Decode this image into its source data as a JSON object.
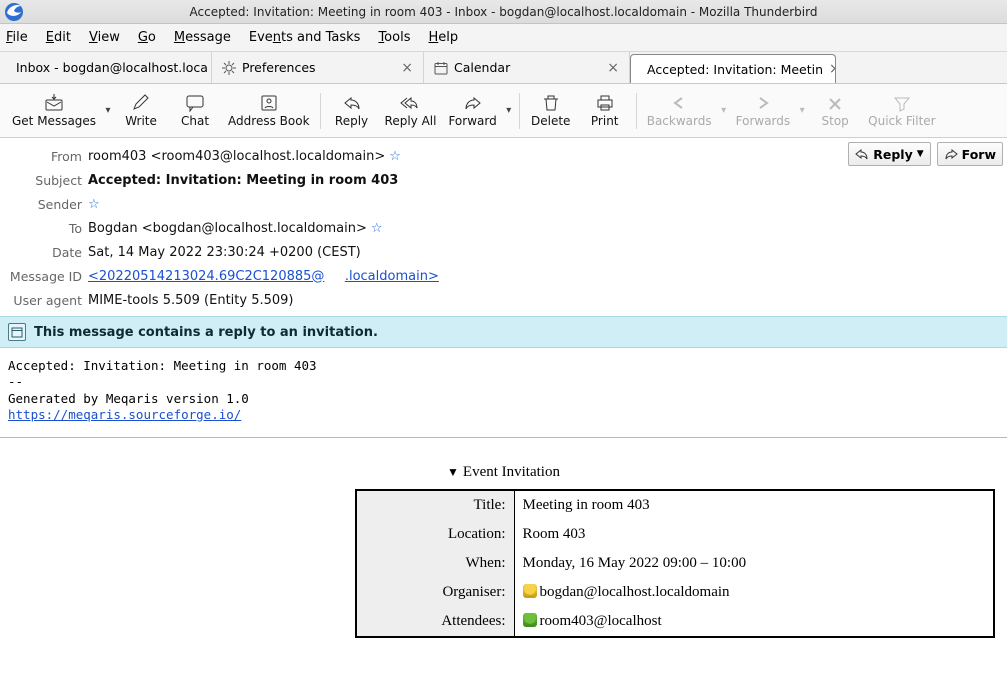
{
  "window": {
    "title": "Accepted: Invitation: Meeting in room 403 - Inbox - bogdan@localhost.localdomain - Mozilla Thunderbird"
  },
  "menubar": {
    "file": "File",
    "edit": "Edit",
    "view": "View",
    "go": "Go",
    "message": "Message",
    "events": "Events and Tasks",
    "tools": "Tools",
    "help": "Help"
  },
  "tabs": {
    "inbox": "Inbox - bogdan@localhost.loca",
    "prefs": "Preferences",
    "calendar": "Calendar",
    "msg": "Accepted: Invitation: Meetin"
  },
  "toolbar": {
    "get": "Get Messages",
    "write": "Write",
    "chat": "Chat",
    "addr": "Address Book",
    "reply": "Reply",
    "replyall": "Reply All",
    "forward": "Forward",
    "delete": "Delete",
    "print": "Print",
    "back": "Backwards",
    "fwdnav": "Forwards",
    "stop": "Stop",
    "qfilter": "Quick Filter"
  },
  "btns": {
    "reply": "Reply",
    "forward": "Forw"
  },
  "hdr": {
    "from_lbl": "From",
    "from_val": "room403 <room403@localhost.localdomain>",
    "subject_lbl": "Subject",
    "subject_val": "Accepted: Invitation: Meeting in room 403",
    "sender_lbl": "Sender",
    "to_lbl": "To",
    "to_val": "Bogdan <bogdan@localhost.localdomain>",
    "date_lbl": "Date",
    "date_val": "Sat, 14 May 2022 23:30:24 +0200 (CEST)",
    "mid_lbl": "Message ID",
    "mid_a": "<20220514213024.69C2C120885@",
    "mid_b": ".localdomain>",
    "ua_lbl": "User agent",
    "ua_val": "MIME-tools 5.509 (Entity 5.509)"
  },
  "info": {
    "text": "This message contains a reply to an invitation."
  },
  "body": {
    "l1": "Accepted: Invitation: Meeting in room 403",
    "l2": "-- ",
    "l3": "Generated by Meqaris version 1.0",
    "link": "https://meqaris.sourceforge.io/"
  },
  "event": {
    "heading": "Event Invitation",
    "title_lbl": "Title:",
    "title_val": "Meeting in room 403",
    "loc_lbl": "Location:",
    "loc_val": "Room 403",
    "when_lbl": "When:",
    "when_val": "Monday, 16 May 2022 09:00 – 10:00",
    "org_lbl": "Organiser:",
    "org_val": "bogdan@localhost.localdomain",
    "att_lbl": "Attendees:",
    "att_val": "room403@localhost"
  }
}
